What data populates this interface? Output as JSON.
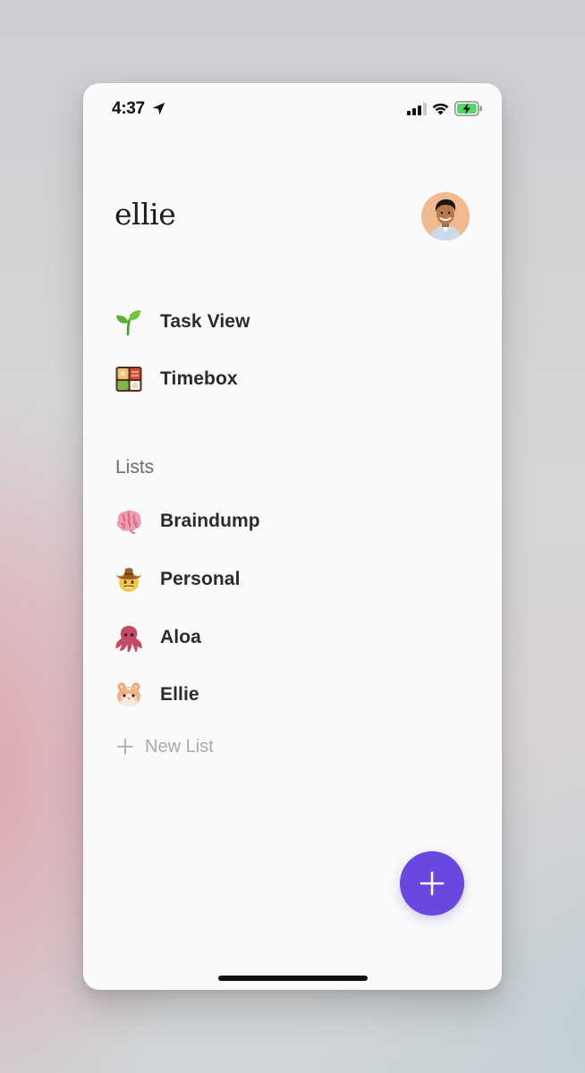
{
  "status_bar": {
    "time": "4:37",
    "location_icon": "location-arrow-icon",
    "signal_icon": "cellular-signal-icon",
    "wifi_icon": "wifi-icon",
    "battery_icon": "battery-charging-icon"
  },
  "header": {
    "title": "ellie",
    "avatar_icon": "user-avatar"
  },
  "nav": {
    "items": [
      {
        "label": "Task View",
        "icon": "seedling-icon"
      },
      {
        "label": "Timebox",
        "icon": "bento-box-icon"
      }
    ]
  },
  "lists": {
    "title": "Lists",
    "items": [
      {
        "label": "Braindump",
        "icon": "brain-icon"
      },
      {
        "label": "Personal",
        "icon": "cowboy-face-icon"
      },
      {
        "label": "Aloa",
        "icon": "octopus-icon"
      },
      {
        "label": "Ellie",
        "icon": "hamster-icon"
      }
    ],
    "new_list_label": "New List"
  },
  "fab": {
    "icon": "plus-icon",
    "color": "#6a47e0"
  }
}
